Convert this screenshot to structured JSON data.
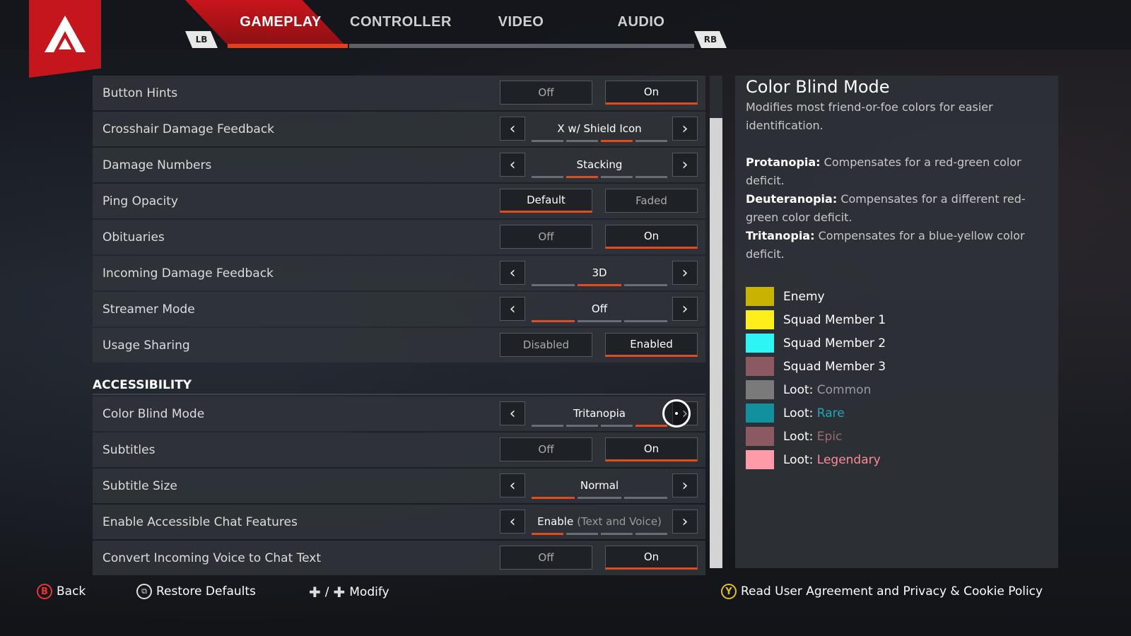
{
  "tabs": {
    "lb": "LB",
    "rb": "RB",
    "items": [
      {
        "label": "GAMEPLAY",
        "active": true
      },
      {
        "label": "CONTROLLER",
        "active": false
      },
      {
        "label": "VIDEO",
        "active": false
      },
      {
        "label": "AUDIO",
        "active": false
      }
    ]
  },
  "settings": {
    "button_hints": {
      "label": "Button Hints",
      "opt1": "Off",
      "opt2": "On"
    },
    "crosshair": {
      "label": "Crosshair Damage Feedback",
      "value": "X w/ Shield Icon",
      "segments": 4,
      "selected_index": 2
    },
    "damage_numbers": {
      "label": "Damage Numbers",
      "value": "Stacking",
      "segments": 3,
      "selected_index": 0
    },
    "ping_opacity": {
      "label": "Ping Opacity",
      "opt1": "Default",
      "opt2": "Faded"
    },
    "obituaries": {
      "label": "Obituaries",
      "opt1": "Off",
      "opt2": "On"
    },
    "incoming_damage": {
      "label": "Incoming Damage Feedback",
      "value": "3D",
      "segments": 3,
      "selected_index": 1
    },
    "streamer_mode": {
      "label": "Streamer Mode",
      "value": "Off",
      "segments": 3,
      "selected_index": 0
    },
    "usage_sharing": {
      "label": "Usage Sharing",
      "opt1": "Disabled",
      "opt2": "Enabled"
    },
    "accessibility_header": "ACCESSIBILITY",
    "color_blind": {
      "label": "Color Blind Mode",
      "value": "Tritanopia",
      "segments": 4,
      "selected_index": 3
    },
    "subtitles": {
      "label": "Subtitles",
      "opt1": "Off",
      "opt2": "On"
    },
    "subtitle_size": {
      "label": "Subtitle Size",
      "value": "Normal",
      "segments": 3,
      "selected_index": 0
    },
    "accessible_chat": {
      "label": "Enable Accessible Chat Features",
      "value": "Enable",
      "value_sub": "(Text and Voice)",
      "segments": 4,
      "selected_index": 0
    },
    "voice_to_text": {
      "label": "Convert Incoming Voice to Chat Text",
      "opt1": "Off",
      "opt2": "On"
    }
  },
  "panel": {
    "title": "Color Blind Mode",
    "description": "Modifies most friend-or-foe colors for easier identification.",
    "protanopia_term": "Protanopia:",
    "protanopia_text": " Compensates for a red-green color deficit.",
    "deuteranopia_term": "Deuteranopia:",
    "deuteranopia_text": " Compensates for a different red-green color deficit.",
    "tritanopia_term": "Tritanopia:",
    "tritanopia_text": " Compensates for a blue-yellow color deficit.",
    "legend": [
      {
        "label": "Enemy",
        "color": "#c8b400"
      },
      {
        "label": "Squad Member 1",
        "color": "#ffee1a"
      },
      {
        "label": "Squad Member 2",
        "color": "#2ef5f5"
      },
      {
        "label": "Squad Member 3",
        "color": "#8a5a60"
      },
      {
        "prefix": "Loot:",
        "rarity": "Common",
        "color": "#7a7a7a",
        "rarity_color": "#9a9a9a"
      },
      {
        "prefix": "Loot:",
        "rarity": "Rare",
        "color": "#12909e",
        "rarity_color": "#1fa8b8"
      },
      {
        "prefix": "Loot:",
        "rarity": "Epic",
        "color": "#8a5a60",
        "rarity_color": "#9a6a70"
      },
      {
        "prefix": "Loot:",
        "rarity": "Legendary",
        "color": "#ff9aa8",
        "rarity_color": "#ff8a9a"
      }
    ]
  },
  "footer": {
    "back_glyph": "B",
    "back": "Back",
    "restore": "Restore Defaults",
    "modify_sep": "/",
    "modify": "Modify",
    "policy_glyph": "Y",
    "policy": "Read User Agreement and Privacy & Cookie Policy"
  },
  "colors": {
    "accent": "#e24a1f",
    "brand_red": "#c4161c"
  }
}
